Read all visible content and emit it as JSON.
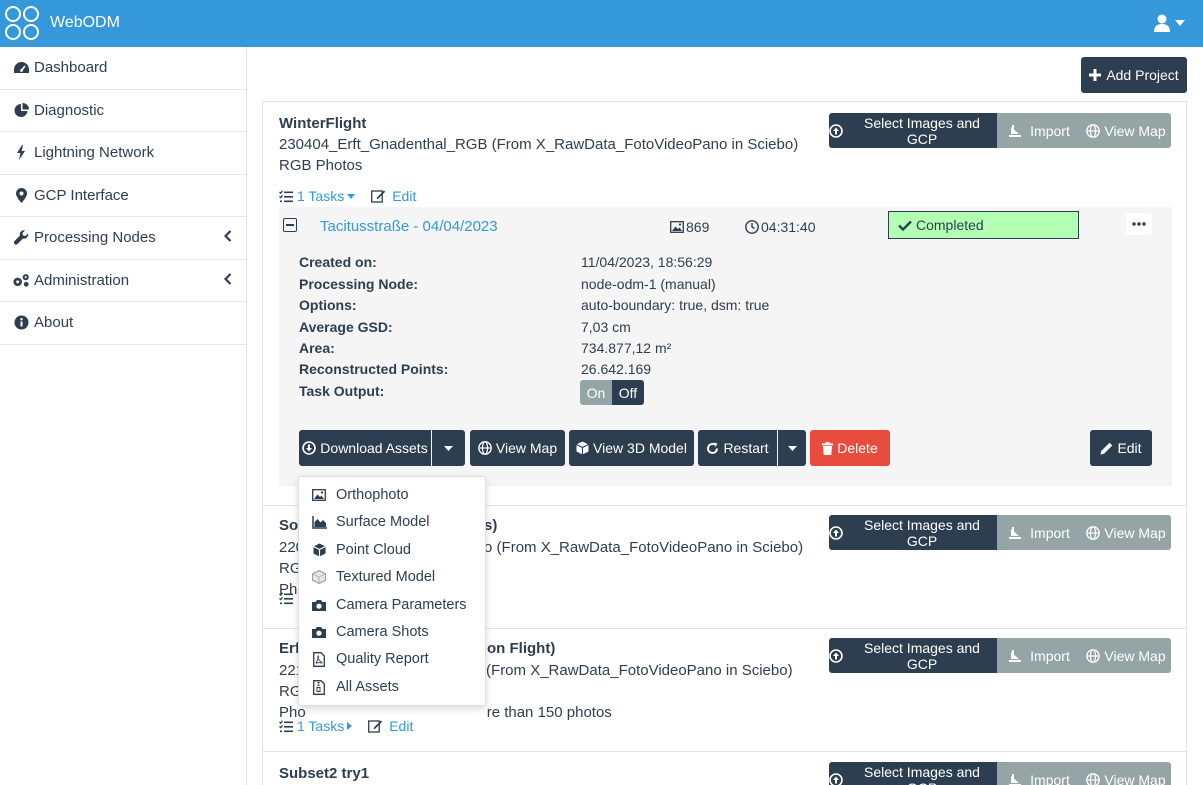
{
  "app": {
    "name": "WebODM"
  },
  "sidebar": {
    "items": [
      {
        "label": "Dashboard",
        "icon": "tachometer-icon"
      },
      {
        "label": "Diagnostic",
        "icon": "pie-chart-icon"
      },
      {
        "label": "Lightning Network",
        "icon": "bolt-icon"
      },
      {
        "label": "GCP Interface",
        "icon": "map-marker-icon"
      },
      {
        "label": "Processing Nodes",
        "icon": "wrench-icon",
        "expandable": true
      },
      {
        "label": "Administration",
        "icon": "cogs-icon",
        "expandable": true
      },
      {
        "label": "About",
        "icon": "info-icon"
      }
    ]
  },
  "toolbar": {
    "add_project": "Add Project"
  },
  "project_buttons": {
    "select": "Select Images and GCP",
    "import": "Import",
    "view_map": "View Map"
  },
  "projects": [
    {
      "title": "WinterFlight",
      "description": "230404_Erft_Gnadenthal_RGB (From X_RawData_FotoVideoPano in Sciebo) RGB Photos",
      "tasks_label": "1 Tasks",
      "edit_label": "Edit"
    },
    {
      "title": "Sor",
      "title_tail": "s)",
      "desc_line1_head": "220",
      "desc_line1_tail": "o (From X_RawData_FotoVideoPano in Sciebo) RGB",
      "desc_line2_head": "Pho"
    },
    {
      "title": "Erf",
      "title_tail": "ion Flight)",
      "desc_line1_head": "221",
      "desc_line1_tail": "(From X_RawData_FotoVideoPano in Sciebo) RGB",
      "desc_line2_head": "Pho",
      "desc_line2_tail": "re than 150 photos",
      "tasks_label": "1 Tasks",
      "edit_label": "Edit"
    },
    {
      "title": "Subset2 try1"
    }
  ],
  "task": {
    "name": "Tacitusstraße - 04/04/2023",
    "image_count": "869",
    "duration": "04:31:40",
    "status": "Completed",
    "details": [
      {
        "label": "Created on:",
        "value": "11/04/2023, 18:56:29"
      },
      {
        "label": "Processing Node:",
        "value": "node-odm-1 (manual)"
      },
      {
        "label": "Options:",
        "value": "auto-boundary: true, dsm: true"
      },
      {
        "label": "Average GSD:",
        "value": "7,03 cm"
      },
      {
        "label": "Area:",
        "value": "734.877,12 m²"
      },
      {
        "label": "Reconstructed Points:",
        "value": "26.642.169"
      },
      {
        "label": "Task Output:",
        "value": ""
      }
    ],
    "output_toggle": {
      "on": "On",
      "off": "Off"
    },
    "actions": {
      "download": "Download Assets",
      "view_map": "View Map",
      "view_3d": "View 3D Model",
      "restart": "Restart",
      "delete": "Delete",
      "edit": "Edit"
    }
  },
  "download_menu": [
    {
      "label": "Orthophoto",
      "icon": "image-icon"
    },
    {
      "label": "Surface Model",
      "icon": "area-chart-icon"
    },
    {
      "label": "Point Cloud",
      "icon": "cube-icon"
    },
    {
      "label": "Textured Model",
      "icon": "textured-cube-icon"
    },
    {
      "label": "Camera Parameters",
      "icon": "camera-icon"
    },
    {
      "label": "Camera Shots",
      "icon": "camera-icon"
    },
    {
      "label": "Quality Report",
      "icon": "pdf-file-icon"
    },
    {
      "label": "All Assets",
      "icon": "zip-file-icon"
    }
  ],
  "colors": {
    "primary": "#3498db",
    "dark": "#2c3e50",
    "grey": "#95a5a6",
    "danger": "#e74c3c",
    "success_bg": "#b3ffb3"
  }
}
